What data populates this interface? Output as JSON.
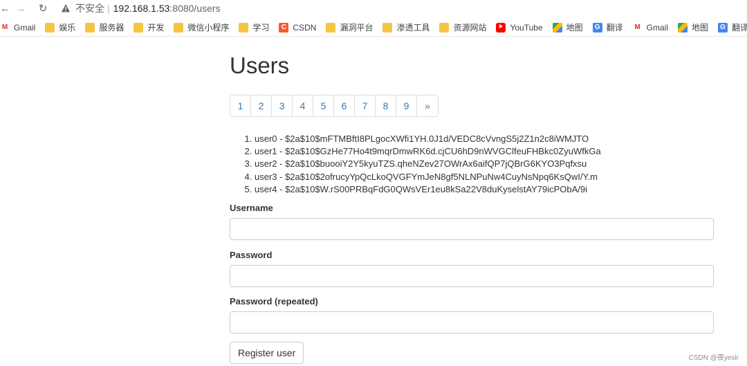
{
  "browser": {
    "insecure_label": "不安全",
    "separator": "|",
    "url_host": "192.168.1.53",
    "url_path": ":8080/users"
  },
  "bookmarks": [
    {
      "label": "Gmail",
      "icon": "gmail-icon"
    },
    {
      "label": "娱乐",
      "icon": "folder-icon"
    },
    {
      "label": "服务器",
      "icon": "folder-icon"
    },
    {
      "label": "开发",
      "icon": "folder-icon"
    },
    {
      "label": "微信小程序",
      "icon": "folder-icon"
    },
    {
      "label": "学习",
      "icon": "folder-icon"
    },
    {
      "label": "CSDN",
      "icon": "csdn-icon"
    },
    {
      "label": "漏洞平台",
      "icon": "folder-icon"
    },
    {
      "label": "渗透工具",
      "icon": "folder-icon"
    },
    {
      "label": "资源网站",
      "icon": "folder-icon"
    },
    {
      "label": "YouTube",
      "icon": "youtube-icon"
    },
    {
      "label": "地图",
      "icon": "maps-icon"
    },
    {
      "label": "翻译",
      "icon": "translate-icon"
    },
    {
      "label": "Gmail",
      "icon": "gmail-icon"
    },
    {
      "label": "地图",
      "icon": "maps-icon"
    },
    {
      "label": "翻译",
      "icon": "translate-icon"
    }
  ],
  "page": {
    "title": "Users",
    "pagination": [
      "1",
      "2",
      "3",
      "4",
      "5",
      "6",
      "7",
      "8",
      "9",
      "»"
    ],
    "users": [
      "user0 - $2a$10$mFTMBftI8PLgocXWfi1YH.0J1d/VEDC8cVvngS5j2Z1n2c8iWMJTO",
      "user1 - $2a$10$GzHe77Ho4t9mqrDmwRK6d.cjCU6hD9nWVGClfeuFHBkc0ZyuWfkGa",
      "user2 - $2a$10$buooiY2Y5kyuTZS.qheNZev27OWrAx6aifQP7jQBrG6KYO3Pqfxsu",
      "user3 - $2a$10$2ofrucyYpQcLkoQVGFYmJeN8gf5NLNPuNw4CuyNsNpq6KsQwI/Y.m",
      "user4 - $2a$10$W.rS00PRBqFdG0QWsVEr1eu8kSa22V8duKyselstAY79icPObA/9i"
    ],
    "form": {
      "username_label": "Username",
      "username_value": "",
      "password_label": "Password",
      "password_value": "",
      "password_repeat_label": "Password (repeated)",
      "password_repeat_value": "",
      "submit_label": "Register user"
    }
  },
  "watermark": "CSDN @夜yesir",
  "colors": {
    "link": "#337ab7",
    "border": "#cccccc",
    "folder": "#f5c542"
  }
}
